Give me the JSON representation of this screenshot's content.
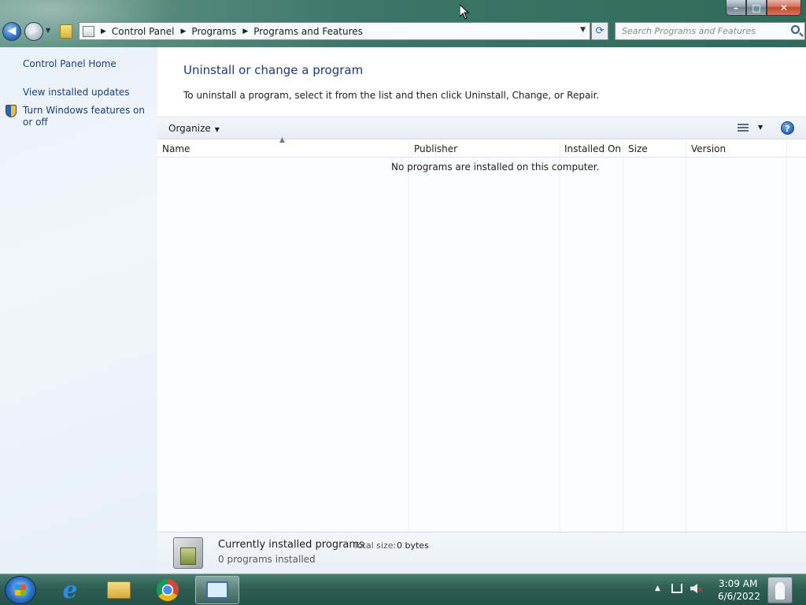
{
  "window": {
    "controls": {
      "minimize": "–",
      "maximize": "□",
      "close": "✕"
    }
  },
  "nav": {
    "back_glyph": "◀",
    "forward_glyph": "▶",
    "breadcrumb": [
      "Control Panel",
      "Programs",
      "Programs and Features"
    ],
    "search_placeholder": "Search Programs and Features"
  },
  "sidebar": {
    "items": [
      {
        "label": "Control Panel Home"
      },
      {
        "label": "View installed updates"
      },
      {
        "label": "Turn Windows features on or off",
        "icon": "shield-icon"
      }
    ]
  },
  "main": {
    "title": "Uninstall or change a program",
    "instructions": "To uninstall a program, select it from the list and then click Uninstall, Change, or Repair.",
    "toolbar": {
      "organize_label": "Organize",
      "help_glyph": "?"
    },
    "columns": [
      "Name",
      "Publisher",
      "Installed On",
      "Size",
      "Version"
    ],
    "sort_column": "Name",
    "empty_message": "No programs are installed on this computer.",
    "details": {
      "title": "Currently installed programs",
      "total_size_label": "Total size:",
      "total_size_value": "0 bytes",
      "count_text": "0 programs installed"
    }
  },
  "taskbar": {
    "apps": [
      "start-button",
      "internet-explorer-icon",
      "windows-explorer-icon",
      "chrome-icon",
      "control-panel-icon"
    ],
    "ie_glyph": "e",
    "clock": {
      "time": "3:09 AM",
      "date": "6/6/2022"
    },
    "tray_icons": [
      "show-hidden-icons",
      "network-icon",
      "volume-muted-icon"
    ]
  },
  "colors": {
    "title_blue": "#1e3a78",
    "link_blue": "#1f3f73",
    "taskbar_green": "#2e5e52"
  }
}
